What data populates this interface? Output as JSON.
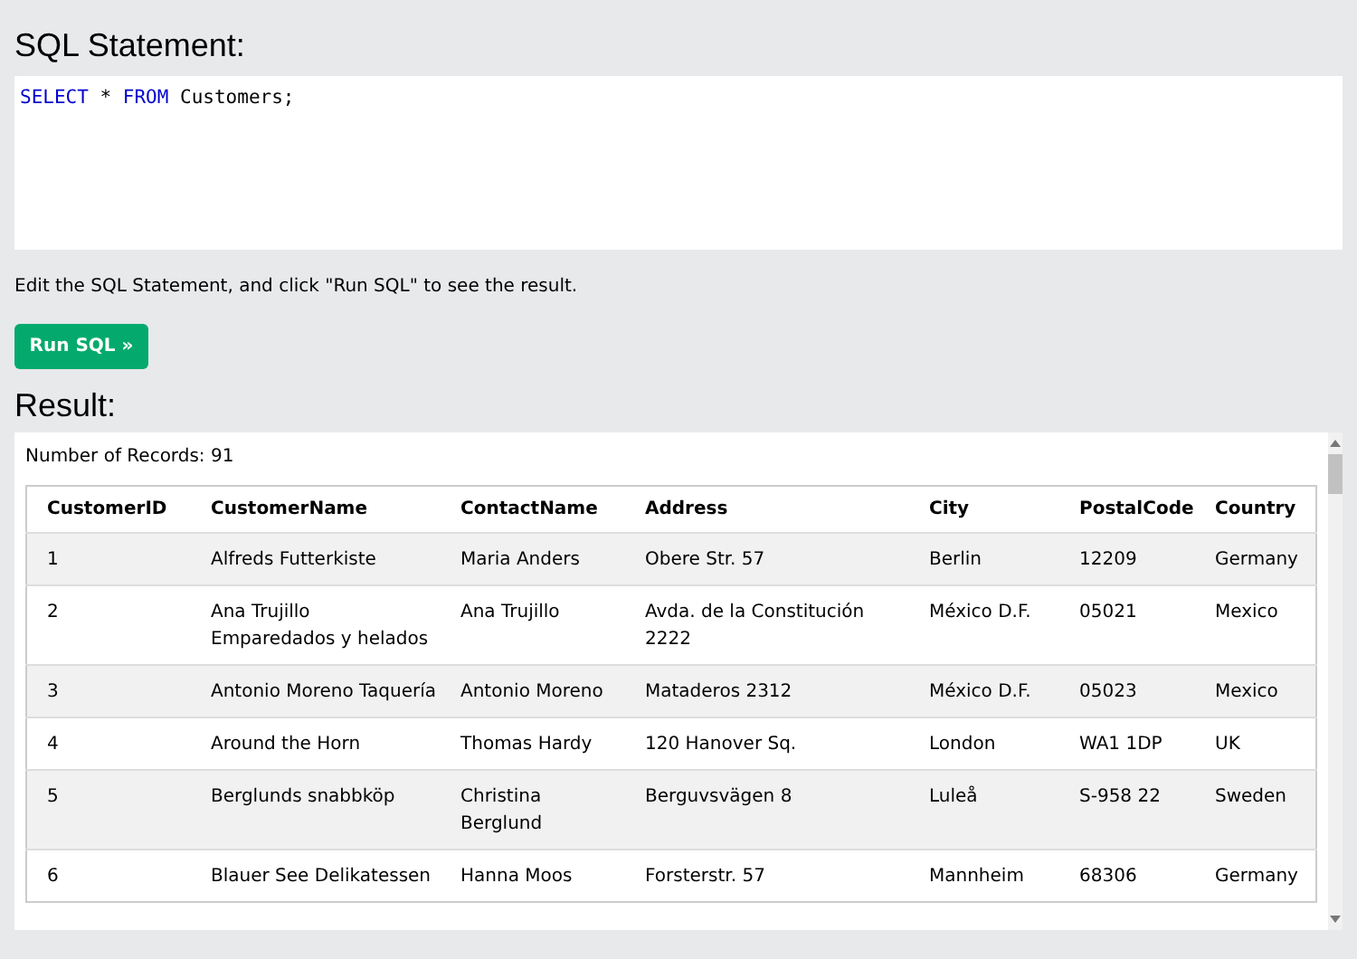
{
  "statement": {
    "heading": "SQL Statement:",
    "code": [
      {
        "kind": "keyword",
        "text": "SELECT"
      },
      {
        "kind": "plain",
        "text": " * "
      },
      {
        "kind": "keyword",
        "text": "FROM"
      },
      {
        "kind": "plain",
        "text": " Customers;"
      }
    ]
  },
  "instructions": "Edit the SQL Statement, and click \"Run SQL\" to see the result.",
  "run_button": "Run SQL »",
  "result": {
    "heading": "Result:",
    "record_count": "Number of Records: 91",
    "table": {
      "columns": [
        "CustomerID",
        "CustomerName",
        "ContactName",
        "Address",
        "City",
        "PostalCode",
        "Country"
      ],
      "rows": [
        [
          "1",
          "Alfreds Futterkiste",
          "Maria Anders",
          "Obere Str. 57",
          "Berlin",
          "12209",
          "Germany"
        ],
        [
          "2",
          "Ana Trujillo Emparedados y helados",
          "Ana Trujillo",
          "Avda. de la Constitución 2222",
          "México D.F.",
          "05021",
          "Mexico"
        ],
        [
          "3",
          "Antonio Moreno Taquería",
          "Antonio Moreno",
          "Mataderos 2312",
          "México D.F.",
          "05023",
          "Mexico"
        ],
        [
          "4",
          "Around the Horn",
          "Thomas Hardy",
          "120 Hanover Sq.",
          "London",
          "WA1 1DP",
          "UK"
        ],
        [
          "5",
          "Berglunds snabbköp",
          "Christina Berglund",
          "Berguvsvägen 8",
          "Luleå",
          "S-958 22",
          "Sweden"
        ],
        [
          "6",
          "Blauer See Delikatessen",
          "Hanna Moos",
          "Forsterstr. 57",
          "Mannheim",
          "68306",
          "Germany"
        ]
      ]
    }
  }
}
